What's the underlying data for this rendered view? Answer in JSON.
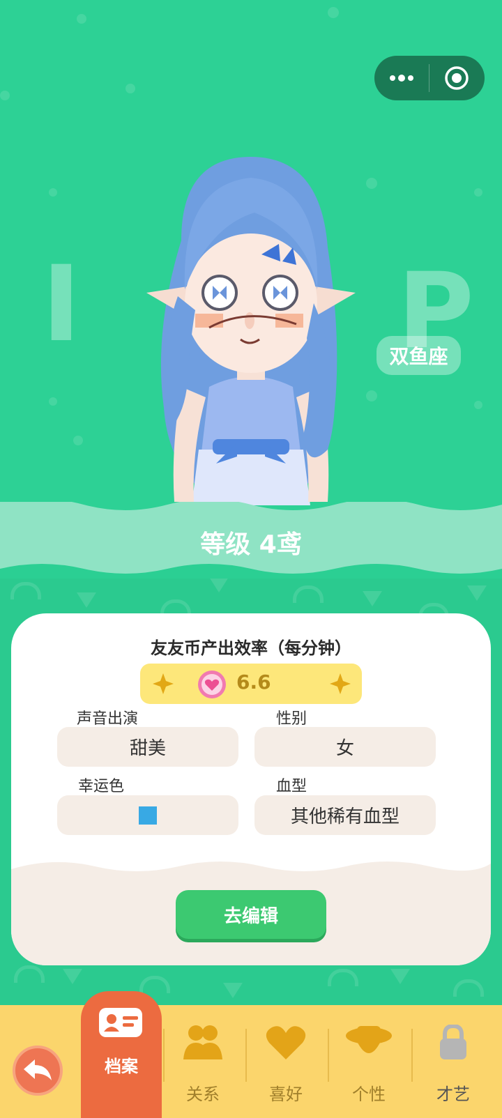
{
  "capsule": {
    "more_icon": "more-dots-icon",
    "close_icon": "target-icon"
  },
  "profile": {
    "zodiac": "双鱼座",
    "level": "等级 4鸢"
  },
  "card": {
    "rate_title": "友友币产出效率（每分钟）",
    "rate_value": "6.6",
    "fields": [
      {
        "label": "声音出演",
        "value": "甜美"
      },
      {
        "label": "性别",
        "value": "女"
      },
      {
        "label": "幸运色",
        "value": "",
        "color": "#38a9e4"
      },
      {
        "label": "血型",
        "value": "其他稀有血型"
      }
    ],
    "edit_button": "去编辑"
  },
  "nav": {
    "tabs": [
      {
        "label": "档案",
        "icon": "id-card-icon",
        "active": true
      },
      {
        "label": "关系",
        "icon": "people-icon"
      },
      {
        "label": "喜好",
        "icon": "heart-icon"
      },
      {
        "label": "个性",
        "icon": "hat-icon"
      },
      {
        "label": "才艺",
        "icon": "lock-icon"
      }
    ]
  },
  "colors": {
    "primary_green": "#2dd195",
    "nav_yellow": "#fbd56c",
    "active_tab": "#ec6b40",
    "button_green": "#3cc971"
  }
}
